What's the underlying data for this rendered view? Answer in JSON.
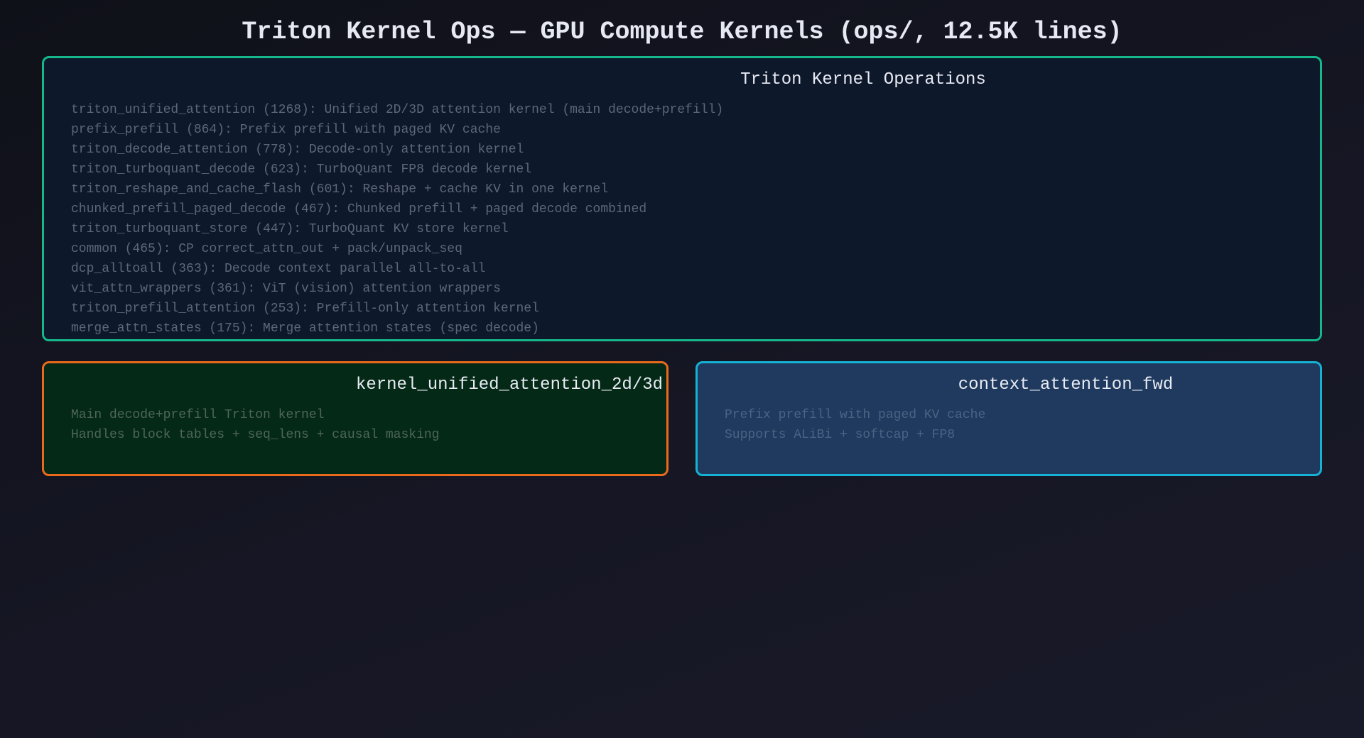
{
  "title": "Triton Kernel Ops — GPU Compute Kernels (ops/, 12.5K lines)",
  "colors": {
    "background": "#151623",
    "title_text": "#e6e8f2",
    "main_border": "#14b88a",
    "main_fill": "#0e182b",
    "unified_border": "#ea6a1c",
    "unified_fill": "#042a17",
    "context_border": "#16b2d5",
    "context_fill": "#1f3a5e"
  },
  "boxes": {
    "main": {
      "heading": "Triton Kernel Operations",
      "lines": [
        "triton_unified_attention (1268): Unified 2D/3D attention kernel (main decode+prefill)",
        "prefix_prefill (864): Prefix prefill with paged KV cache",
        "triton_decode_attention (778): Decode-only attention kernel",
        "triton_turboquant_decode (623): TurboQuant FP8 decode kernel",
        "triton_reshape_and_cache_flash (601): Reshape + cache KV in one kernel",
        "chunked_prefill_paged_decode (467): Chunked prefill + paged decode combined",
        "triton_turboquant_store (447): TurboQuant KV store kernel",
        "common (465): CP correct_attn_out + pack/unpack_seq",
        "dcp_alltoall (363): Decode context parallel all-to-all",
        "vit_attn_wrappers (361): ViT (vision) attention wrappers",
        "triton_prefill_attention (253): Prefill-only attention kernel",
        "merge_attn_states (175): Merge attention states (spec decode)"
      ]
    },
    "unified": {
      "heading": "kernel_unified_attention_2d/3d",
      "lines": [
        "Main decode+prefill Triton kernel",
        "Handles block tables + seq_lens + causal masking"
      ]
    },
    "context": {
      "heading": "context_attention_fwd",
      "lines": [
        "Prefix prefill with paged KV cache",
        "Supports ALiBi + softcap + FP8"
      ]
    }
  }
}
